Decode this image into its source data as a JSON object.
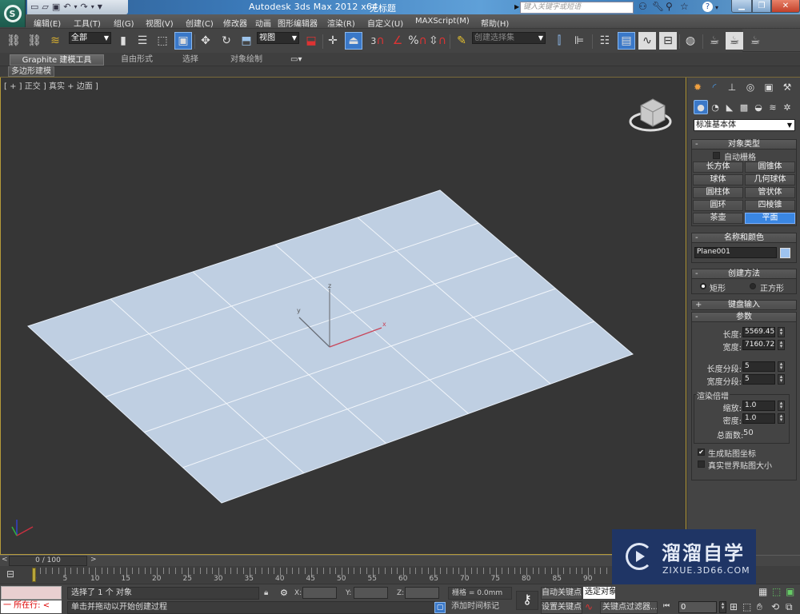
{
  "titlebar": {
    "app_title": "Autodesk 3ds Max  2012 x64",
    "document": "无标题",
    "search_placeholder": "键入关键字或短语",
    "qat_icons": [
      "new-file-icon",
      "open-file-icon",
      "save-icon",
      "undo-icon",
      "redo-icon",
      "customize-icon"
    ]
  },
  "menu": {
    "items": [
      "编辑(E)",
      "工具(T)",
      "组(G)",
      "视图(V)",
      "创建(C)",
      "修改器",
      "动画",
      "图形编辑器",
      "渲染(R)",
      "自定义(U)",
      "MAXScript(M)",
      "帮助(H)"
    ]
  },
  "toolbar": {
    "selection_filter": "全部",
    "ref_coord": "视图",
    "named_selection": "创建选择集",
    "snap_label": "3"
  },
  "ribbon": {
    "tabs": [
      "Graphite 建模工具",
      "自由形式",
      "选择",
      "对象绘制"
    ],
    "subtab": "多边形建模"
  },
  "viewport": {
    "label": "[ + ] 正交 ] 真实 + 边面 ]",
    "grid_segments": {
      "length": 5,
      "width": 5
    },
    "plane_color": "#bfcfe2",
    "axis_labels": {
      "x": "x",
      "y": "y",
      "z": "z"
    }
  },
  "command_panel": {
    "category": "标准基本体",
    "object_type": {
      "title": "对象类型",
      "autogrid_label": "自动栅格",
      "autogrid_checked": false,
      "buttons": [
        "长方体",
        "圆锥体",
        "球体",
        "几何球体",
        "圆柱体",
        "管状体",
        "圆环",
        "四棱锥",
        "茶壶",
        "平面"
      ],
      "active": "平面"
    },
    "name_color": {
      "title": "名称和颜色",
      "name": "Plane001",
      "color": "#9ec3f0"
    },
    "creation_method": {
      "title": "创建方法",
      "options": [
        "矩形",
        "正方形"
      ],
      "selected": "矩形"
    },
    "keyboard_entry": {
      "title": "键盘输入"
    },
    "parameters": {
      "title": "参数",
      "length_label": "长度:",
      "length": "5569.452",
      "width_label": "宽度:",
      "width": "7160.723",
      "length_segs_label": "长度分段:",
      "length_segs": "5",
      "width_segs_label": "宽度分段:",
      "width_segs": "5",
      "render_group": "渲染倍增",
      "scale_label": "缩放:",
      "scale": "1.0",
      "density_label": "密度:",
      "density": "1.0",
      "total_faces_label": "总面数:",
      "total_faces": "50",
      "gen_map_coords": "生成贴图坐标",
      "gen_map_coords_checked": true,
      "real_world_map": "真实世界贴图大小",
      "real_world_map_checked": false
    }
  },
  "timeline": {
    "frame_range": "0 / 100",
    "current_frame": 0,
    "total_frames": 100,
    "tick_labels": [
      "0",
      "5",
      "10",
      "15",
      "20",
      "25",
      "30",
      "35",
      "40",
      "45",
      "50",
      "55",
      "60",
      "65",
      "70",
      "75",
      "80",
      "85",
      "90"
    ]
  },
  "status": {
    "listener_text": "一  所在行:  <",
    "selection": "选择了 1 个 对象",
    "prompt": "单击并拖动以开始创建过程",
    "x_label": "X:",
    "y_label": "Y:",
    "z_label": "Z:",
    "grid": "栅格 = 0.0mm",
    "add_time_tag": "添加时间标记",
    "auto_key": "自动关键点",
    "set_key": "设置关键点",
    "selected_objects": "选定对象",
    "key_filters": "关键点过滤器...",
    "frame_value": "0"
  },
  "watermark": {
    "title": "溜溜自学",
    "url": "ZIXUE.3D66.COM"
  }
}
